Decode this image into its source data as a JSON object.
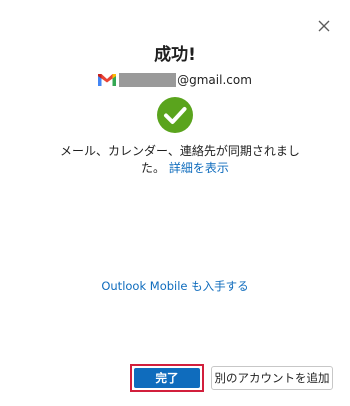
{
  "dialog": {
    "title": "成功!",
    "account": {
      "email_suffix": "@gmail.com",
      "icon": "gmail-icon"
    },
    "status_icon": "success-check-icon",
    "message": {
      "line1": "メール、カレンダー、連絡先が同期されまし",
      "line2_prefix": "た。",
      "details_link": "詳細を表示"
    },
    "mobile_link": "Outlook Mobile も入手する",
    "buttons": {
      "done": "完了",
      "add_another": "別のアカウントを追加"
    }
  },
  "colors": {
    "accent": "#0f6cbd",
    "success": "#5aa41d",
    "highlight_border": "#d21f3c",
    "redacted": "#9a9a9a"
  }
}
